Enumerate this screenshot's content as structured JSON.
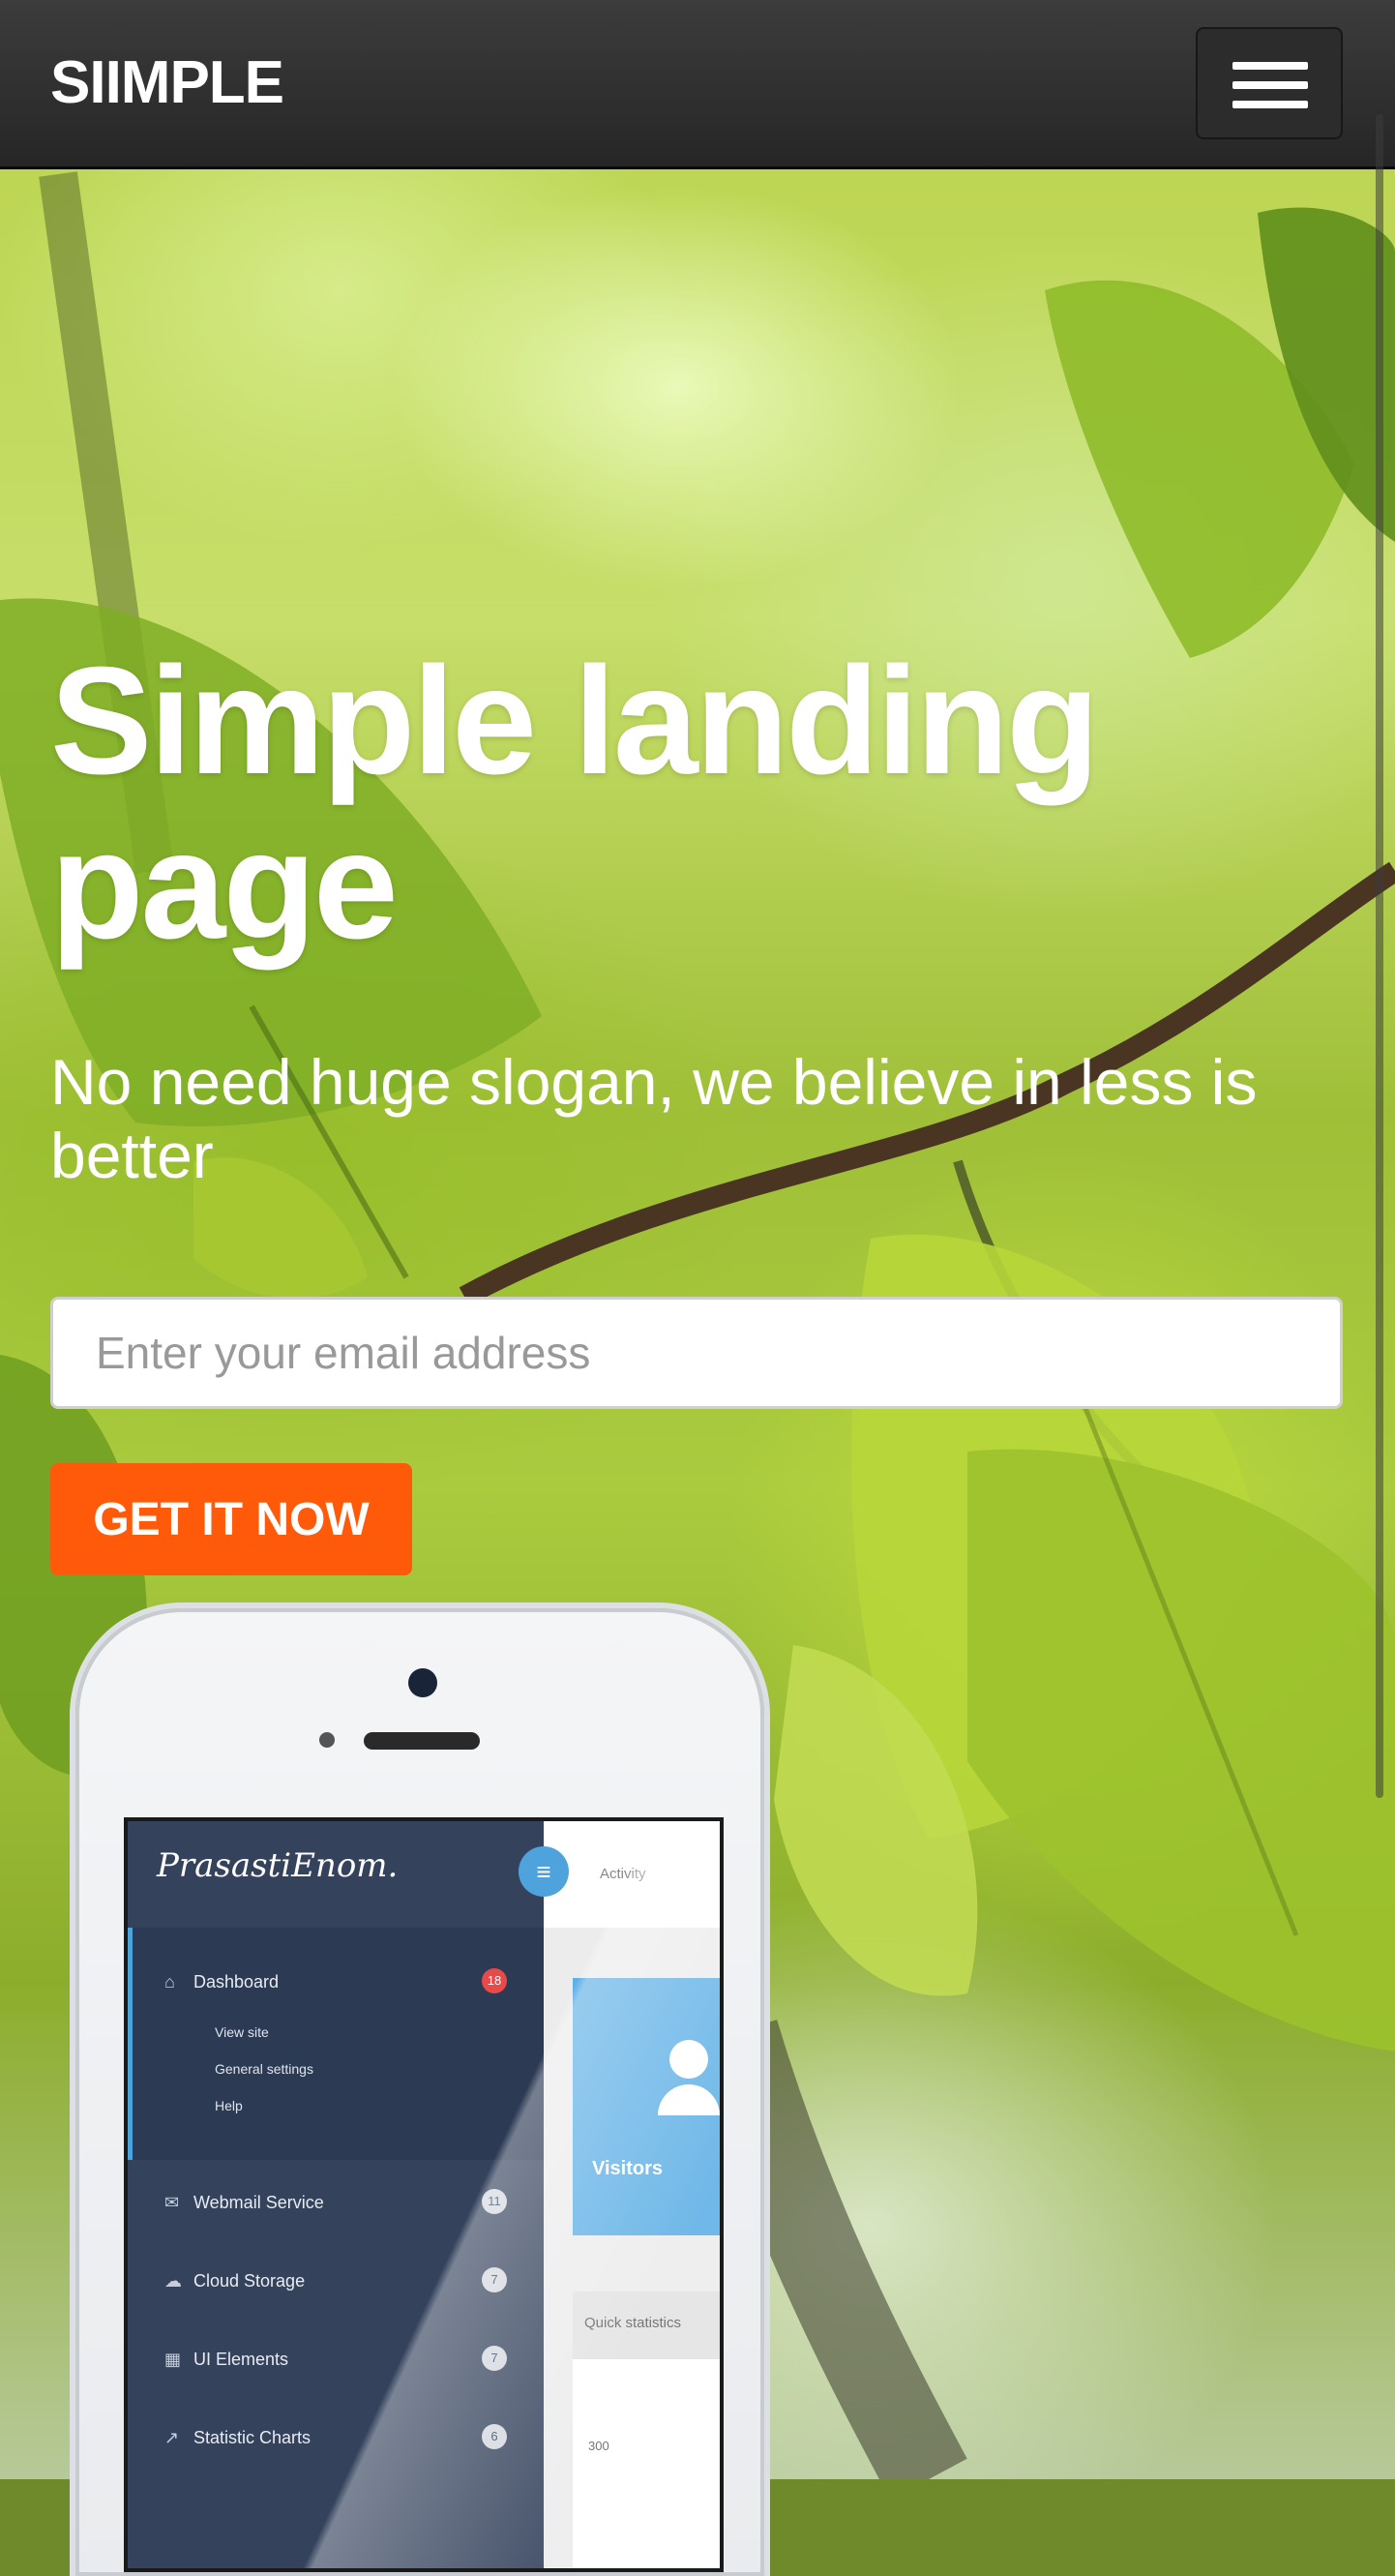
{
  "navbar": {
    "brand": "SIIMPLE",
    "menu_icon": "hamburger-menu-icon"
  },
  "hero": {
    "title": "Simple landing page",
    "slogan": "No need huge slogan, we believe in less is better",
    "email_placeholder": "Enter your email address",
    "cta_label": "GET IT NOW"
  },
  "colors": {
    "navbar": "#2e2e2e",
    "cta": "#ff5a0a",
    "sidebar": "#34425c",
    "accent": "#4fa3dd"
  },
  "phone_screen": {
    "logo": "PrasastiEnom.",
    "top_tab": "Activity",
    "sidebar": {
      "dashboard": {
        "label": "Dashboard",
        "badge": "18",
        "icon": "home-icon"
      },
      "dashboard_sub": [
        "View site",
        "General settings",
        "Help"
      ],
      "items": [
        {
          "label": "Webmail Service",
          "badge": "11",
          "icon": "mail-icon"
        },
        {
          "label": "Cloud Storage",
          "badge": "7",
          "icon": "cloud-icon"
        },
        {
          "label": "UI Elements",
          "badge": "7",
          "icon": "calendar-icon"
        },
        {
          "label": "Statistic Charts",
          "badge": "6",
          "icon": "chart-icon"
        }
      ]
    },
    "visitors_label": "Visitors",
    "quick_stats_label": "Quick statistics",
    "chart_axis_tick": "300"
  }
}
